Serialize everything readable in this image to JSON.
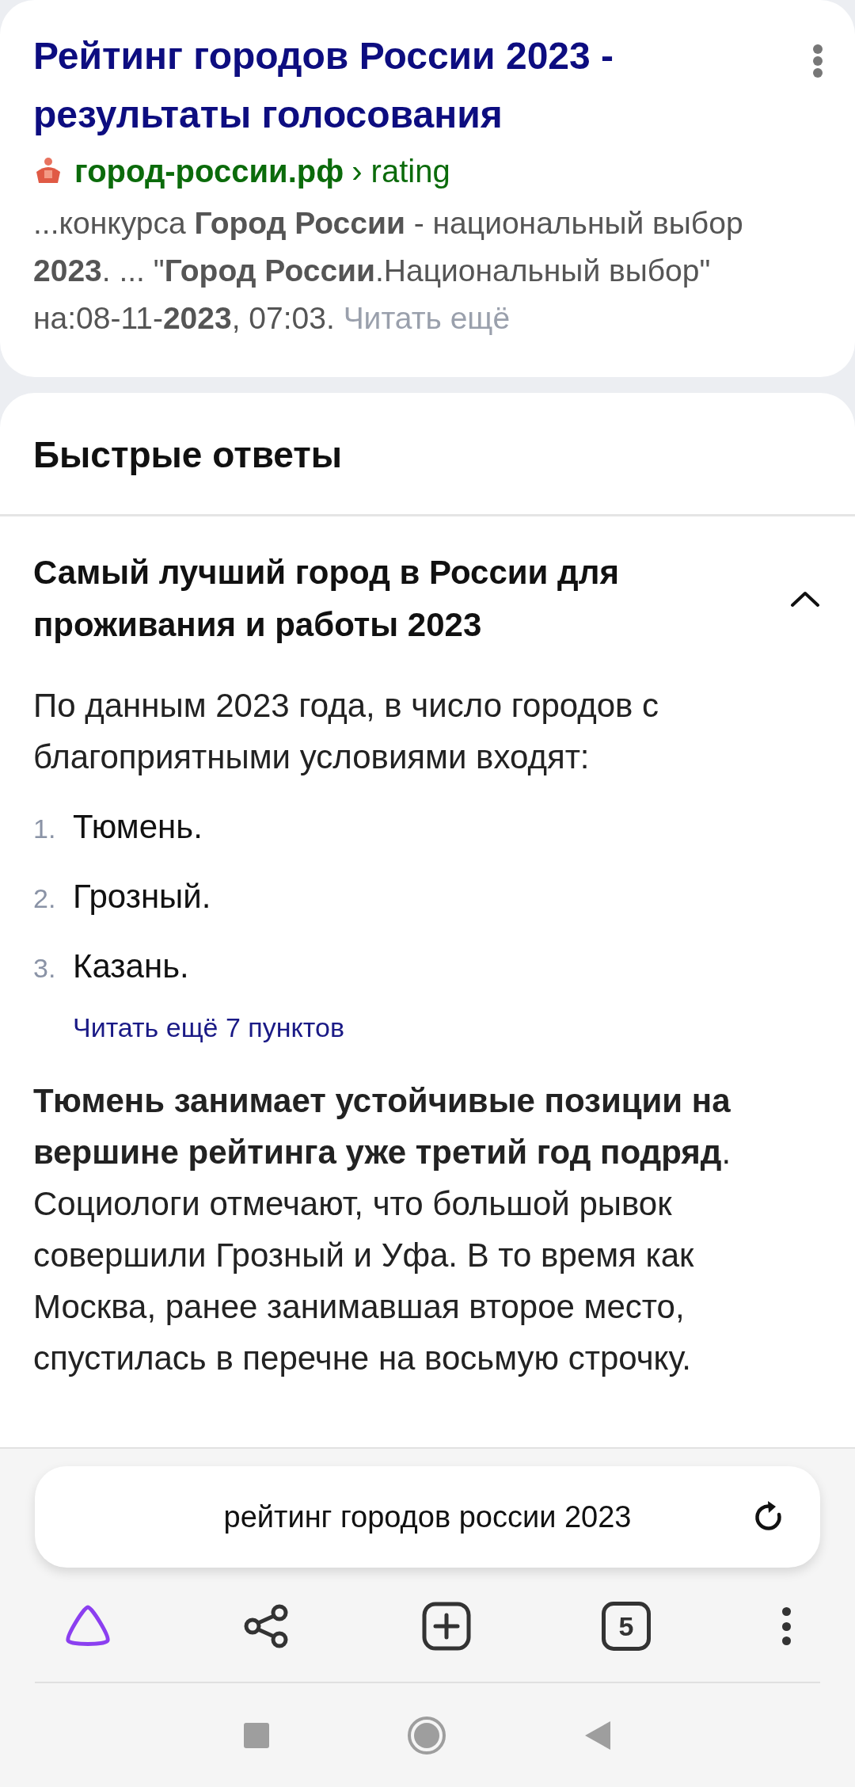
{
  "result": {
    "title": "Рейтинг городов России 2023 - результаты голосования",
    "domain": "город-россии.рф",
    "path": "› rating",
    "snippet": "...конкурса **Город России** - национальный выбор **2023**. ... \"**Город России**.Национальный выбор\" на:08-11-**2023**, 07:03.",
    "more": "Читать ещё"
  },
  "quick_answers": {
    "heading": "Быстрые ответы",
    "question": {
      "text": "Самый лучший город в России для проживания и работы 2023",
      "expanded": true
    },
    "intro": "По данным 2023 года, в число городов с благоприятными условиями входят:",
    "items": [
      {
        "number": "1.",
        "text": "Тюмень."
      },
      {
        "number": "2.",
        "text": "Грозный."
      },
      {
        "number": "3.",
        "text": "Казань."
      }
    ],
    "more": "Читать ещё 7 пунктов",
    "summary": "**Тюмень занимает устойчивые позиции на вершине рейтинга уже третий год подряд**. Социологи отмечают, что большой рывок совершили Грозный и Уфа. В то время как Москва, ранее занимавшая второе место, спустилась в перечне на восьмую строчку."
  },
  "search_bar": {
    "value": "рейтинг городов россии 2023"
  },
  "toolbar": {
    "tab_count": "5"
  }
}
